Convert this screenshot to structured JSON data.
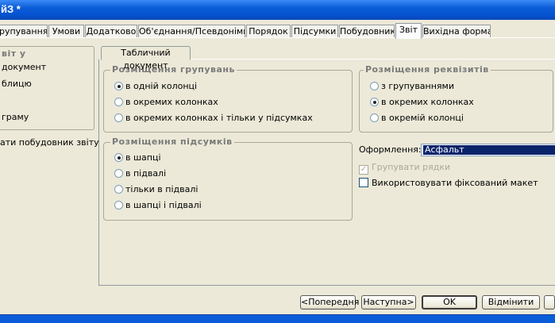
{
  "window": {
    "title": "йЗ *"
  },
  "tabs": [
    {
      "label": "рупування",
      "active": false
    },
    {
      "label": "Умови",
      "active": false
    },
    {
      "label": "Додатково",
      "active": false
    },
    {
      "label": "Об'єднання/Псевдоніми",
      "active": false
    },
    {
      "label": "Порядок",
      "active": false
    },
    {
      "label": "Підсумки",
      "active": false
    },
    {
      "label": "Побудовник",
      "active": false
    },
    {
      "label": "Звіт",
      "active": true
    },
    {
      "label": "Вихідна форма",
      "active": false
    }
  ],
  "left_panel": {
    "title": "віт у",
    "items": [
      "документ",
      "блицю",
      "граму"
    ],
    "link": "ати побудовник звіту"
  },
  "subtab": {
    "label": "Табличний документ"
  },
  "groupings": {
    "title": "Розміщення групувань",
    "options": [
      {
        "label": "в одній колонці",
        "selected": true
      },
      {
        "label": "в окремих колонках",
        "selected": false
      },
      {
        "label": "в окремих колонках і тільки у підсумках",
        "selected": false
      }
    ]
  },
  "totals": {
    "title": "Розміщення підсумків",
    "options": [
      {
        "label": "в шапці",
        "selected": true
      },
      {
        "label": "в підвалі",
        "selected": false
      },
      {
        "label": "тільки в підвалі",
        "selected": false
      },
      {
        "label": "в шапці і підвалі",
        "selected": false
      }
    ]
  },
  "details": {
    "title": "Розміщення реквізитів",
    "options": [
      {
        "label": "з групуваннями",
        "selected": false
      },
      {
        "label": "в окремих колонках",
        "selected": true
      },
      {
        "label": "в окремій колонці",
        "selected": false
      }
    ]
  },
  "design": {
    "label": "Оформлення:",
    "value": "Асфальт"
  },
  "checkboxes": {
    "group_rows": {
      "label": "Групувати рядки",
      "checked": true,
      "disabled": true
    },
    "fixed_layout": {
      "label": "Використовувати фіксований макет",
      "checked": false,
      "disabled": false
    }
  },
  "buttons": {
    "prev": "<Попередня",
    "next": "Наступна>",
    "ok": "OK",
    "cancel": "Відмінити"
  },
  "colors": {
    "titlebar": "#0b5cd8",
    "selection": "#0a246a",
    "group_title": "#7a7a7a"
  }
}
